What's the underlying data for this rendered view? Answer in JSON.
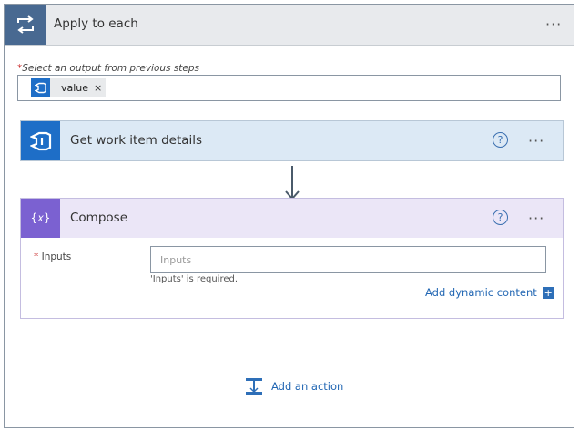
{
  "apply_to_each": {
    "title": "Apply to each",
    "menu_label": "···",
    "field_required_mark": "*",
    "field_label": "Select an output from previous steps",
    "token": {
      "label": "value",
      "remove_label": "×",
      "icon": "azure-devops-icon"
    }
  },
  "get_work_item": {
    "title": "Get work item details",
    "help_label": "?",
    "menu_label": "···",
    "icon": "azure-devops-icon",
    "header_color": "#dce9f5",
    "icon_color": "#1e6ec7"
  },
  "compose": {
    "title": "Compose",
    "icon_text": "{𝑥}",
    "help_label": "?",
    "menu_label": "···",
    "header_color": "#ebe6f7",
    "icon_color": "#7b61d1",
    "inputs_required_mark": "*",
    "inputs_label": "Inputs",
    "inputs_placeholder": "Inputs",
    "inputs_value": "",
    "validation_message": "'Inputs' is required.",
    "add_dynamic_content_label": "Add dynamic content",
    "add_dynamic_plus": "+"
  },
  "add_action": {
    "label": "Add an action",
    "icon": "add-action-icon"
  },
  "colors": {
    "accent": "#2166b3",
    "loop_header_icon_bg": "#486991"
  }
}
